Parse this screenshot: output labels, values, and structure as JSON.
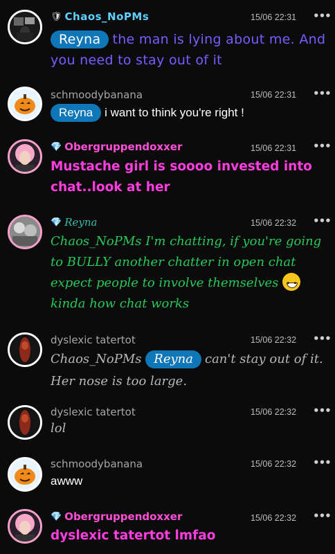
{
  "messages": [
    {
      "user": "Chaos_NoPMs",
      "badge": "🛡",
      "time": "15/06 22:31",
      "avatar": "crowd-collage-avatar",
      "mention": "Reyna",
      "text": "the man is lying about me. And you need to stay out of it",
      "color": "#7b5cff"
    },
    {
      "user": "schmoodybanana",
      "time": "15/06 22:31",
      "avatar": "pumpkin-avatar",
      "mention": "Reyna",
      "text": "i want to think you're right !",
      "color": "#ffffff"
    },
    {
      "user": "Obergruppendoxxer",
      "badge": "💎",
      "time": "15/06 22:31",
      "avatar": "pink-hair-avatar",
      "text": "Mustache girl is soooo invested into chat..look at her",
      "color": "#ff3ee0"
    },
    {
      "user": "Reyna",
      "badge": "💎",
      "time": "15/06 22:32",
      "avatar": "kitten-avatar",
      "text": "Chaos_NoPMs I'm chatting, if you're going to BULLY another chatter in open chat expect people to involve themselves",
      "text2": "kinda how chat works",
      "emoji": "grinning-emoji",
      "color": "#27c95a"
    },
    {
      "user": "dyslexic tatertot",
      "time": "15/06 22:32",
      "avatar": "red-figure-avatar",
      "prefix": "Chaos_NoPMs",
      "mention": "Reyna",
      "text": "can't stay out of it. Her nose is too large.",
      "color": "#b8b8b8"
    },
    {
      "user": "dyslexic tatertot",
      "time": "15/06 22:32",
      "avatar": "red-figure-avatar",
      "text": "lol",
      "color": "#b8b8b8"
    },
    {
      "user": "schmoodybanana",
      "time": "15/06 22:32",
      "avatar": "pumpkin-avatar",
      "text": "awww",
      "color": "#ffffff"
    },
    {
      "user": "Obergruppendoxxer",
      "badge": "💎",
      "time": "15/06 22:32",
      "avatar": "pink-hair-avatar",
      "text": "dyslexic tatertot lmfao",
      "color": "#ff3ee0"
    }
  ],
  "more_icon": "•••"
}
